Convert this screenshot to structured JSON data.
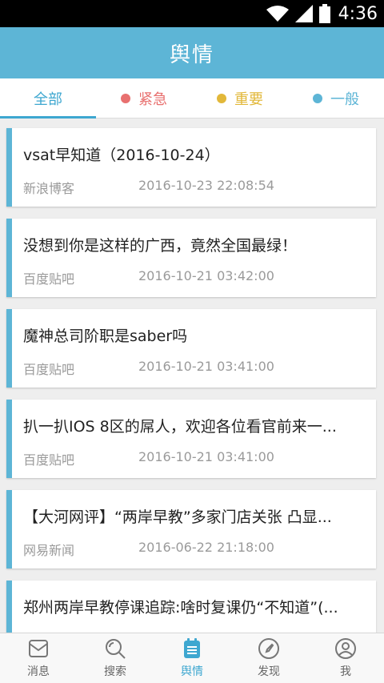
{
  "status_bar": {
    "time": "4:36",
    "icons": [
      "wifi-icon",
      "signal-icon",
      "battery-icon"
    ]
  },
  "app_bar": {
    "title": "舆情"
  },
  "tabs": [
    {
      "label": "全部",
      "active": true
    },
    {
      "label": "紧急",
      "dot_color": "#e8706f"
    },
    {
      "label": "重要",
      "dot_color": "#e2b83a"
    },
    {
      "label": "一般",
      "dot_color": "#5db5d6"
    }
  ],
  "items": [
    {
      "title": "vsat早知道（2016-10-24）",
      "source": "新浪博客",
      "time": "2016-10-23 22:08:54"
    },
    {
      "title": "没想到你是这样的广西，竟然全国最绿！",
      "source": "百度贴吧",
      "time": "2016-10-21 03:42:00"
    },
    {
      "title": "魔神总司阶职是saber吗",
      "source": "百度贴吧",
      "time": "2016-10-21 03:41:00"
    },
    {
      "title": "扒一扒IOS 8区的屌人，欢迎各位看官前来一...",
      "source": "百度贴吧",
      "time": "2016-10-21 03:41:00"
    },
    {
      "title": "【大河网评】“两岸早教”多家门店关张 凸显...",
      "source": "网易新闻",
      "time": "2016-06-22 21:18:00"
    },
    {
      "title": "郑州两岸早教停课追踪:啥时复课仍“不知道”(...",
      "source": "",
      "time": ""
    }
  ],
  "bottom_nav": [
    {
      "label": "消息",
      "icon": "message-icon"
    },
    {
      "label": "搜索",
      "icon": "search-icon"
    },
    {
      "label": "舆情",
      "icon": "sentiment-icon",
      "active": true
    },
    {
      "label": "发现",
      "icon": "compass-icon"
    },
    {
      "label": "我",
      "icon": "profile-icon"
    }
  ],
  "colors": {
    "primary": "#5db5d6",
    "active": "#3ea7d0",
    "urgent": "#e8706f",
    "important": "#e2b83a"
  }
}
